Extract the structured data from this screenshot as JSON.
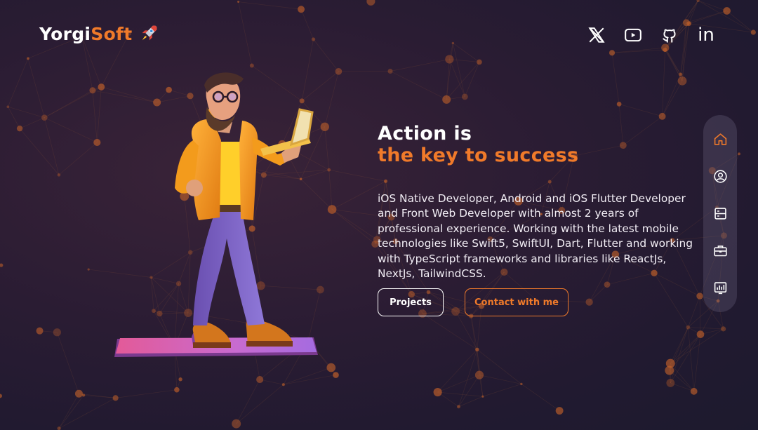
{
  "header": {
    "logo_primary": "Yorgi",
    "logo_accent": "Soft",
    "logo_icon": "rocket-icon",
    "social": [
      {
        "name": "x-twitter",
        "icon": "x-icon"
      },
      {
        "name": "youtube",
        "icon": "youtube-icon"
      },
      {
        "name": "github",
        "icon": "github-icon"
      },
      {
        "name": "linkedin",
        "icon": "linkedin-icon",
        "text": "in"
      }
    ]
  },
  "hero": {
    "title_line1": "Action is",
    "title_line2": "the key to success",
    "description": "iOS Native Developer, Android and iOS Flutter Developer and Front Web Developer with almost 2 years of professional experience. Working with the latest mobile technologies like Swift5, SwiftUI, Dart, Flutter and working with TypeScript frameworks and libraries like ReactJs, NextJs, TailwindCSS.",
    "projects_label": "Projects",
    "contact_label": "Contact with me"
  },
  "sidenav": [
    {
      "id": "home",
      "icon": "home-icon",
      "active": true
    },
    {
      "id": "about",
      "icon": "user-circle-icon",
      "active": false
    },
    {
      "id": "experience",
      "icon": "list-box-icon",
      "active": false
    },
    {
      "id": "projects",
      "icon": "briefcase-icon",
      "active": false
    },
    {
      "id": "stats",
      "icon": "chart-icon",
      "active": false
    }
  ],
  "colors": {
    "accent": "#f07a2a",
    "text": "#ffffff",
    "background": "#221a31"
  }
}
